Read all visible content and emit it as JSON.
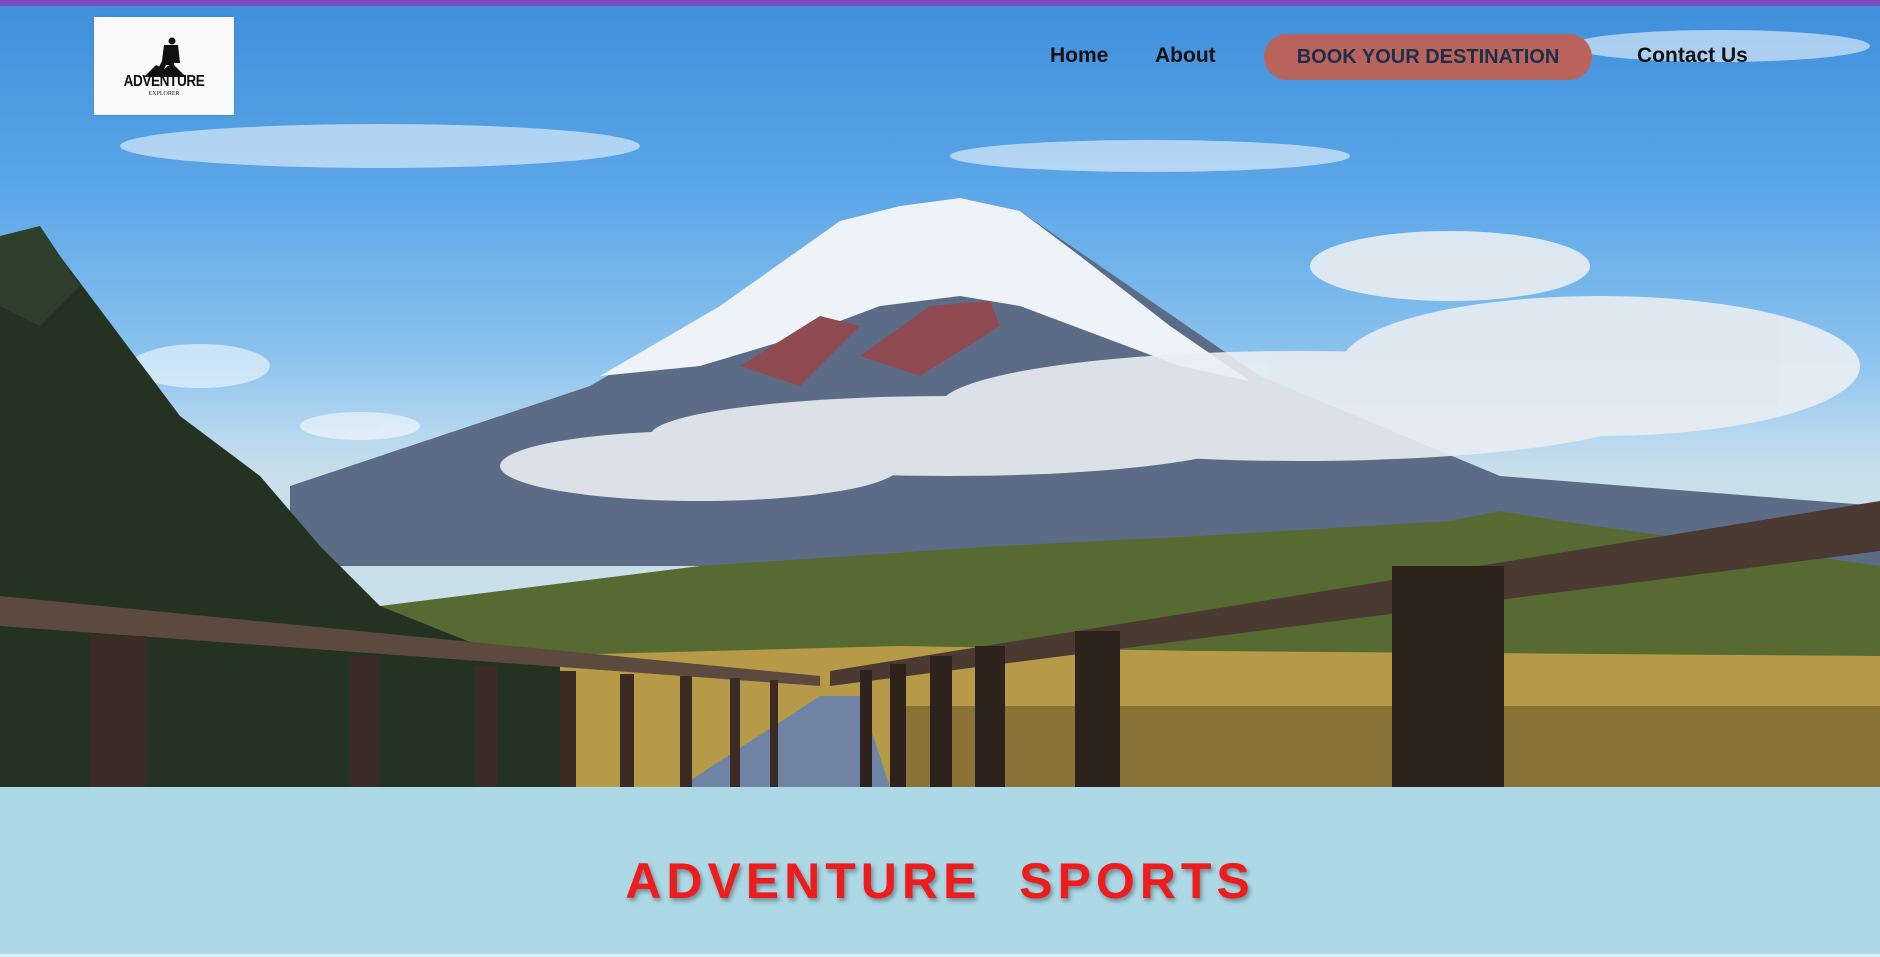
{
  "header": {
    "logo": {
      "title": "ADVENTURE",
      "subtitle": "EXPLORER",
      "icon": "hiker-icon"
    },
    "nav": {
      "home": "Home",
      "about": "About",
      "book": "BOOK YOUR DESTINATION",
      "contact": "Contact Us"
    }
  },
  "hero": {
    "image": "mountain-boardwalk-landscape"
  },
  "section": {
    "title": "ADVENTURE  SPORTS"
  },
  "colors": {
    "top_bar": "#7b4bc0",
    "book_button": "#b8635b",
    "title": "#ee1c1c",
    "band": "#add8e6"
  }
}
